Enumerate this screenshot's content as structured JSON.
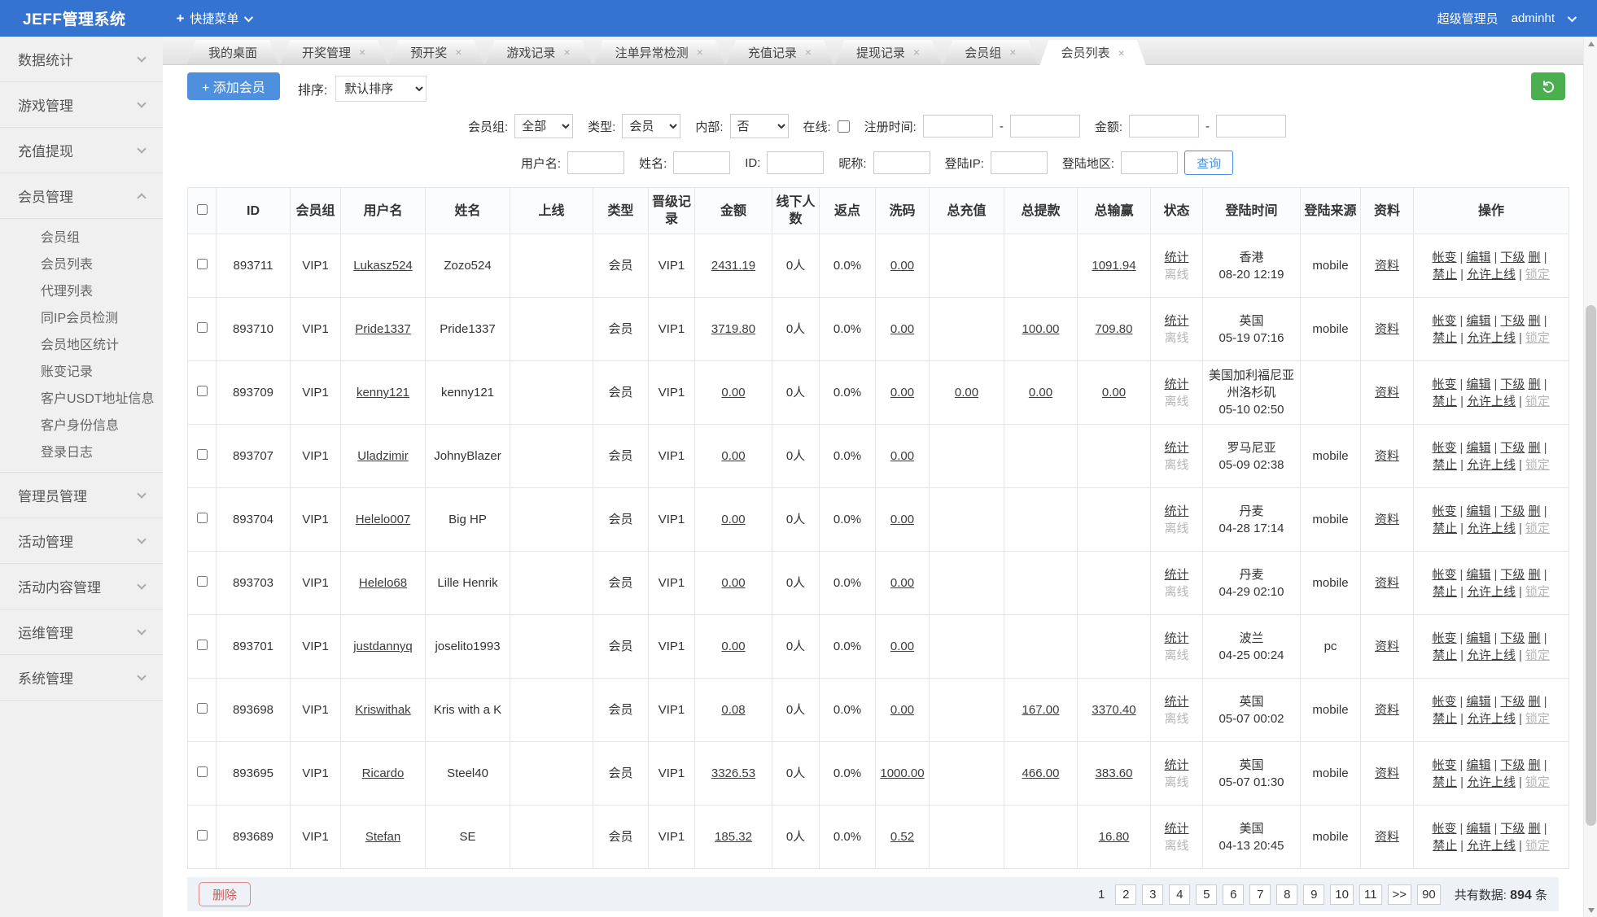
{
  "colors": {
    "navbar": "#3573d1",
    "accent": "#4a89dc",
    "refresh_green": "#4bae4f",
    "danger": "#d9534f"
  },
  "icons": {
    "close": "×",
    "plus": "+"
  },
  "navbar": {
    "brand": "JEFF管理系统",
    "quick_menu": "快捷菜单",
    "role": "超级管理员",
    "username": "adminht"
  },
  "sidebar": {
    "sections_top": [
      {
        "label": "数据统计"
      },
      {
        "label": "游戏管理"
      },
      {
        "label": "充值提现"
      }
    ],
    "expanded": {
      "label": "会员管理",
      "items": [
        {
          "label": "会员组"
        },
        {
          "label": "会员列表"
        },
        {
          "label": "代理列表"
        },
        {
          "label": "同IP会员检测"
        },
        {
          "label": "会员地区统计"
        },
        {
          "label": "账变记录"
        },
        {
          "label": "客户USDT地址信息"
        },
        {
          "label": "客户身份信息"
        },
        {
          "label": "登录日志"
        }
      ]
    },
    "sections_bottom": [
      {
        "label": "管理员管理"
      },
      {
        "label": "活动管理"
      },
      {
        "label": "活动内容管理"
      },
      {
        "label": "运维管理"
      },
      {
        "label": "系统管理"
      }
    ]
  },
  "tabs": {
    "home": "我的桌面",
    "items": [
      "开奖管理",
      "预开奖",
      "游戏记录",
      "注单异常检测",
      "充值记录",
      "提现记录",
      "会员组"
    ],
    "active": "会员列表"
  },
  "toolbar": {
    "add_label": "添加会员",
    "sort_label": "排序:",
    "sort_value": "默认排序"
  },
  "filters": {
    "row1": {
      "group_label": "会员组:",
      "group_value": "全部",
      "type_label": "类型:",
      "type_value": "会员",
      "internal_label": "内部:",
      "internal_value": "否",
      "online_label": "在线:",
      "regtime_label": "注册时间:",
      "dash": "-",
      "amount_label": "金额:"
    },
    "row2": {
      "username_label": "用户名:",
      "name_label": "姓名:",
      "id_label": "ID:",
      "nick_label": "昵称:",
      "ip_label": "登陆IP:",
      "area_label": "登陆地区:",
      "search_button": "查询"
    }
  },
  "labels": {
    "sep": "|",
    "status_top": "统计",
    "status_bottom": "离线",
    "profile": "资料",
    "ops": [
      "帐变",
      "编辑",
      "下级",
      "删",
      "禁止",
      "允许上线",
      "锁定"
    ]
  },
  "table": {
    "headers": [
      "ID",
      "会员组",
      "用户名",
      "姓名",
      "上线",
      "类型",
      "晋级记录",
      "金额",
      "线下人数",
      "返点",
      "洗码",
      "总充值",
      "总提款",
      "总输赢",
      "状态",
      "登陆时间",
      "登陆来源",
      "资料",
      "操作"
    ],
    "rows": [
      {
        "id": "893711",
        "group": "VIP1",
        "username": "Lukasz524",
        "name": "Zozo524",
        "upline": "",
        "type": "会员",
        "promo": "VIP1",
        "amount": "2431.19",
        "downline": "0人",
        "rebate": "0.0%",
        "wash": "0.00",
        "deposit": "",
        "withdraw": "",
        "winloss": "1091.94",
        "area": "香港",
        "time": "08-20 12:19",
        "source": "mobile"
      },
      {
        "id": "893710",
        "group": "VIP1",
        "username": "Pride1337",
        "name": "Pride1337",
        "upline": "",
        "type": "会员",
        "promo": "VIP1",
        "amount": "3719.80",
        "downline": "0人",
        "rebate": "0.0%",
        "wash": "0.00",
        "deposit": "",
        "withdraw": "100.00",
        "winloss": "709.80",
        "area": "英国",
        "time": "05-19 07:16",
        "source": "mobile"
      },
      {
        "id": "893709",
        "group": "VIP1",
        "username": "kenny121",
        "name": "kenny121",
        "upline": "",
        "type": "会员",
        "promo": "VIP1",
        "amount": "0.00",
        "downline": "0人",
        "rebate": "0.0%",
        "wash": "0.00",
        "deposit": "0.00",
        "withdraw": "0.00",
        "winloss": "0.00",
        "area": "美国加利福尼亚州洛杉矶",
        "time": "05-10 02:50",
        "source": ""
      },
      {
        "id": "893707",
        "group": "VIP1",
        "username": "Uladzimir",
        "name": "JohnyBlazer",
        "upline": "",
        "type": "会员",
        "promo": "VIP1",
        "amount": "0.00",
        "downline": "0人",
        "rebate": "0.0%",
        "wash": "0.00",
        "deposit": "",
        "withdraw": "",
        "winloss": "",
        "area": "罗马尼亚",
        "time": "05-09 02:38",
        "source": "mobile"
      },
      {
        "id": "893704",
        "group": "VIP1",
        "username": "Helelo007",
        "name": "Big HP",
        "upline": "",
        "type": "会员",
        "promo": "VIP1",
        "amount": "0.00",
        "downline": "0人",
        "rebate": "0.0%",
        "wash": "0.00",
        "deposit": "",
        "withdraw": "",
        "winloss": "",
        "area": "丹麦",
        "time": "04-28 17:14",
        "source": "mobile"
      },
      {
        "id": "893703",
        "group": "VIP1",
        "username": "Helelo68",
        "name": "Lille Henrik",
        "upline": "",
        "type": "会员",
        "promo": "VIP1",
        "amount": "0.00",
        "downline": "0人",
        "rebate": "0.0%",
        "wash": "0.00",
        "deposit": "",
        "withdraw": "",
        "winloss": "",
        "area": "丹麦",
        "time": "04-29 02:10",
        "source": "mobile"
      },
      {
        "id": "893701",
        "group": "VIP1",
        "username": "justdannyq",
        "name": "joselito1993",
        "upline": "",
        "type": "会员",
        "promo": "VIP1",
        "amount": "0.00",
        "downline": "0人",
        "rebate": "0.0%",
        "wash": "0.00",
        "deposit": "",
        "withdraw": "",
        "winloss": "",
        "area": "波兰",
        "time": "04-25 00:24",
        "source": "pc"
      },
      {
        "id": "893698",
        "group": "VIP1",
        "username": "Kriswithak",
        "name": "Kris with a K",
        "upline": "",
        "type": "会员",
        "promo": "VIP1",
        "amount": "0.08",
        "downline": "0人",
        "rebate": "0.0%",
        "wash": "0.00",
        "deposit": "",
        "withdraw": "167.00",
        "winloss": "3370.40",
        "area": "英国",
        "time": "05-07 00:02",
        "source": "mobile"
      },
      {
        "id": "893695",
        "group": "VIP1",
        "username": "Ricardo",
        "name": "Steel40",
        "upline": "",
        "type": "会员",
        "promo": "VIP1",
        "amount": "3326.53",
        "downline": "0人",
        "rebate": "0.0%",
        "wash": "1000.00",
        "deposit": "",
        "withdraw": "466.00",
        "winloss": "383.60",
        "area": "英国",
        "time": "05-07 01:30",
        "source": "mobile"
      },
      {
        "id": "893689",
        "group": "VIP1",
        "username": "Stefan",
        "name": "SE",
        "upline": "",
        "type": "会员",
        "promo": "VIP1",
        "amount": "185.32",
        "downline": "0人",
        "rebate": "0.0%",
        "wash": "0.52",
        "deposit": "",
        "withdraw": "",
        "winloss": "16.80",
        "area": "美国",
        "time": "04-13 20:45",
        "source": "mobile"
      }
    ]
  },
  "footer": {
    "delete_label": "删除",
    "current_page": "1",
    "pages": [
      "2",
      "3",
      "4",
      "5",
      "6",
      "7",
      "8",
      "9",
      "10",
      "11",
      ">>",
      "90"
    ],
    "total_label": "共有数据:",
    "total_value": "894",
    "total_unit": "条"
  }
}
